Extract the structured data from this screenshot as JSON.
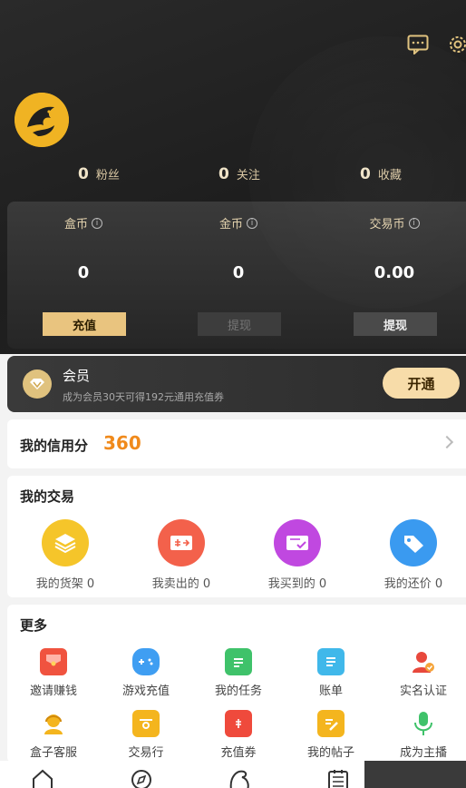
{
  "stats": [
    {
      "num": "0",
      "label": "粉丝"
    },
    {
      "num": "0",
      "label": "关注"
    },
    {
      "num": "0",
      "label": "收藏"
    }
  ],
  "wallet": [
    {
      "name": "盒币",
      "value": "0",
      "button": "充值"
    },
    {
      "name": "金币",
      "value": "0",
      "button": "提现"
    },
    {
      "name": "交易币",
      "value": "0.00",
      "button": "提现"
    }
  ],
  "info_glyph": "i",
  "member": {
    "title": "会员",
    "subtitle": "成为会员30天可得192元通用充值券",
    "button": "开通"
  },
  "credit": {
    "label": "我的信用分",
    "score": "360"
  },
  "trade": {
    "title": "我的交易",
    "items": [
      {
        "label": "我的货架 0",
        "icon": "stack-icon",
        "color": "#f5c52a"
      },
      {
        "label": "我卖出的 0",
        "icon": "sell-ticket-icon",
        "color": "#f3614b"
      },
      {
        "label": "我买到的 0",
        "icon": "bought-check-icon",
        "color": "#c048e0"
      },
      {
        "label": "我的还价 0",
        "icon": "price-tag-icon",
        "color": "#3a9af0"
      }
    ]
  },
  "more": {
    "title": "更多",
    "items": [
      {
        "label": "邀请赚钱",
        "icon": "red-envelope-icon",
        "color": "#f0533f"
      },
      {
        "label": "游戏充值",
        "icon": "gamepad-icon",
        "color": "#3f9ef2"
      },
      {
        "label": "我的任务",
        "icon": "task-clipboard-icon",
        "color": "#3fc26a"
      },
      {
        "label": "账单",
        "icon": "bill-icon",
        "color": "#40b8ea"
      },
      {
        "label": "实名认证",
        "icon": "verify-user-icon",
        "color": "#e8483c"
      },
      {
        "label": "盒子客服",
        "icon": "customer-service-icon",
        "color": "#f4b51e"
      },
      {
        "label": "交易行",
        "icon": "shop-icon",
        "color": "#f4b51e"
      },
      {
        "label": "充值券",
        "icon": "coupon-icon",
        "color": "#ef4a3c"
      },
      {
        "label": "我的帖子",
        "icon": "post-edit-icon",
        "color": "#f4b51e"
      },
      {
        "label": "成为主播",
        "icon": "microphone-icon",
        "color": "#3fc26a"
      }
    ]
  },
  "colors": {
    "accent_gold": "#e9c47f",
    "credit_orange": "#f08a1c"
  }
}
